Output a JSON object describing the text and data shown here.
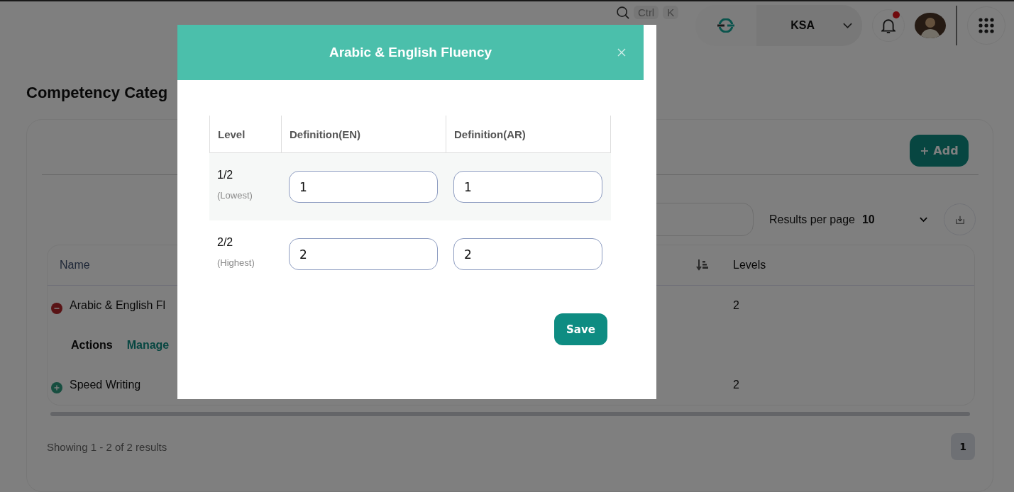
{
  "topbar": {
    "search_keys": [
      "Ctrl",
      "K"
    ],
    "region": "KSA",
    "notifications_unread": true
  },
  "page": {
    "title": "Competency Categ",
    "add_button": "+ Add",
    "results_per_page": {
      "label": "Results per page",
      "value": "10"
    },
    "table": {
      "columns": [
        "Name",
        "Levels"
      ],
      "rows": [
        {
          "name": "Arabic & English Fl",
          "levels": "2",
          "expanded": true,
          "actions_label": "Actions",
          "action_link": "Manage"
        },
        {
          "name": "Speed Writing",
          "levels": "2",
          "expanded": false
        }
      ]
    },
    "summary": "Showing 1 - 2 of 2 results",
    "pages": [
      {
        "label": "1",
        "selected": true
      }
    ]
  },
  "modal": {
    "title": "Arabic & English Fluency",
    "columns": [
      "Level",
      "Definition(EN)",
      "Definition(AR)"
    ],
    "rows": [
      {
        "level": "1/2",
        "note": "(Lowest)",
        "definition_en": "1",
        "definition_ar": "1"
      },
      {
        "level": "2/2",
        "note": "(Highest)",
        "definition_en": "2",
        "definition_ar": "2"
      }
    ],
    "save_button": "Save"
  }
}
